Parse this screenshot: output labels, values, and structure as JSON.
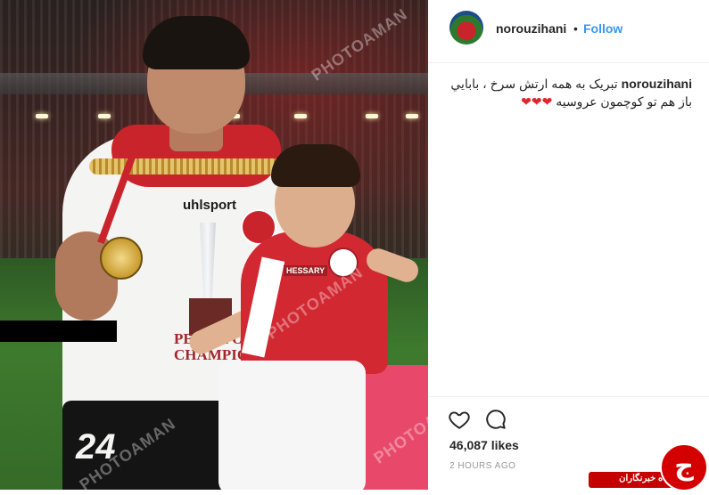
{
  "photo": {
    "watermark": "PHOTOAMAN",
    "shirt_brand": "uhlsport",
    "shorts_number": "24",
    "shirt_text_1": "PERSEPOLIS",
    "shirt_text_2": "CHAMPION",
    "child_shirt_logo": "HESSARY"
  },
  "post": {
    "username": "norouzihani",
    "follow_label": "Follow",
    "caption_line1": "تبريک به همه ارتش سرخ ، بابايي",
    "caption_line2": "باز هم تو کوچمون عروسيه",
    "caption_hearts": "❤❤❤",
    "likes": "46,087 likes",
    "time": "2 HOURS AGO"
  },
  "corner_badge": {
    "text": "باشگاه خبرنگاران",
    "logo_glyph": "ج"
  },
  "icons": [
    "heart-icon",
    "comment-icon"
  ]
}
